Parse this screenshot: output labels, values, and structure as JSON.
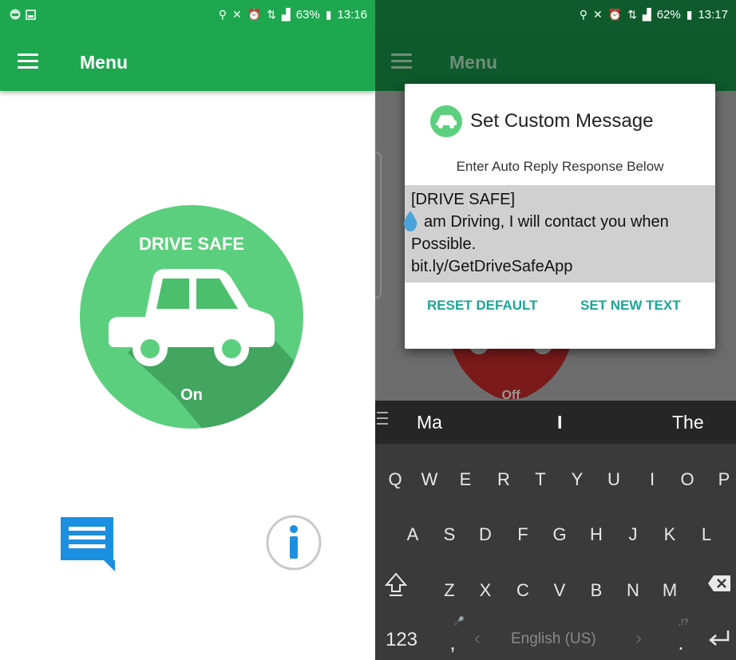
{
  "left": {
    "status": {
      "battery": "63%",
      "time": "13:16"
    },
    "appbar": {
      "title": "Menu"
    },
    "logo": {
      "title": "DRIVE SAFE",
      "state": "On"
    }
  },
  "right": {
    "status": {
      "battery": "62%",
      "time": "13:17"
    },
    "appbar": {
      "title": "Menu"
    },
    "background_state": "Off",
    "dialog": {
      "title": "Set Custom Message",
      "subtitle": "Enter Auto Reply Response Below",
      "message_lines": [
        "[DRIVE SAFE]",
        "am Driving, I will contact you when",
        "Possible.",
        "bit.ly/GetDriveSafeApp"
      ],
      "reset_label": "RESET DEFAULT",
      "set_label": "SET NEW TEXT"
    },
    "keyboard": {
      "suggestions": [
        "Ma",
        "I",
        "The"
      ],
      "row1": [
        "Q",
        "W",
        "E",
        "R",
        "T",
        "Y",
        "U",
        "I",
        "O",
        "P"
      ],
      "row2": [
        "A",
        "S",
        "D",
        "F",
        "G",
        "H",
        "J",
        "K",
        "L"
      ],
      "row3": [
        "Z",
        "X",
        "C",
        "V",
        "B",
        "N",
        "M"
      ],
      "numbers_key": "123",
      "comma_key": ",",
      "period_key": ".",
      "punct_hint": ",!?",
      "space_label": "English (US)"
    }
  },
  "colors": {
    "brand_green": "#1fa74f",
    "logo_green": "#5bcf7d",
    "accent_teal": "#1aa696",
    "info_blue": "#1b8fe0"
  }
}
